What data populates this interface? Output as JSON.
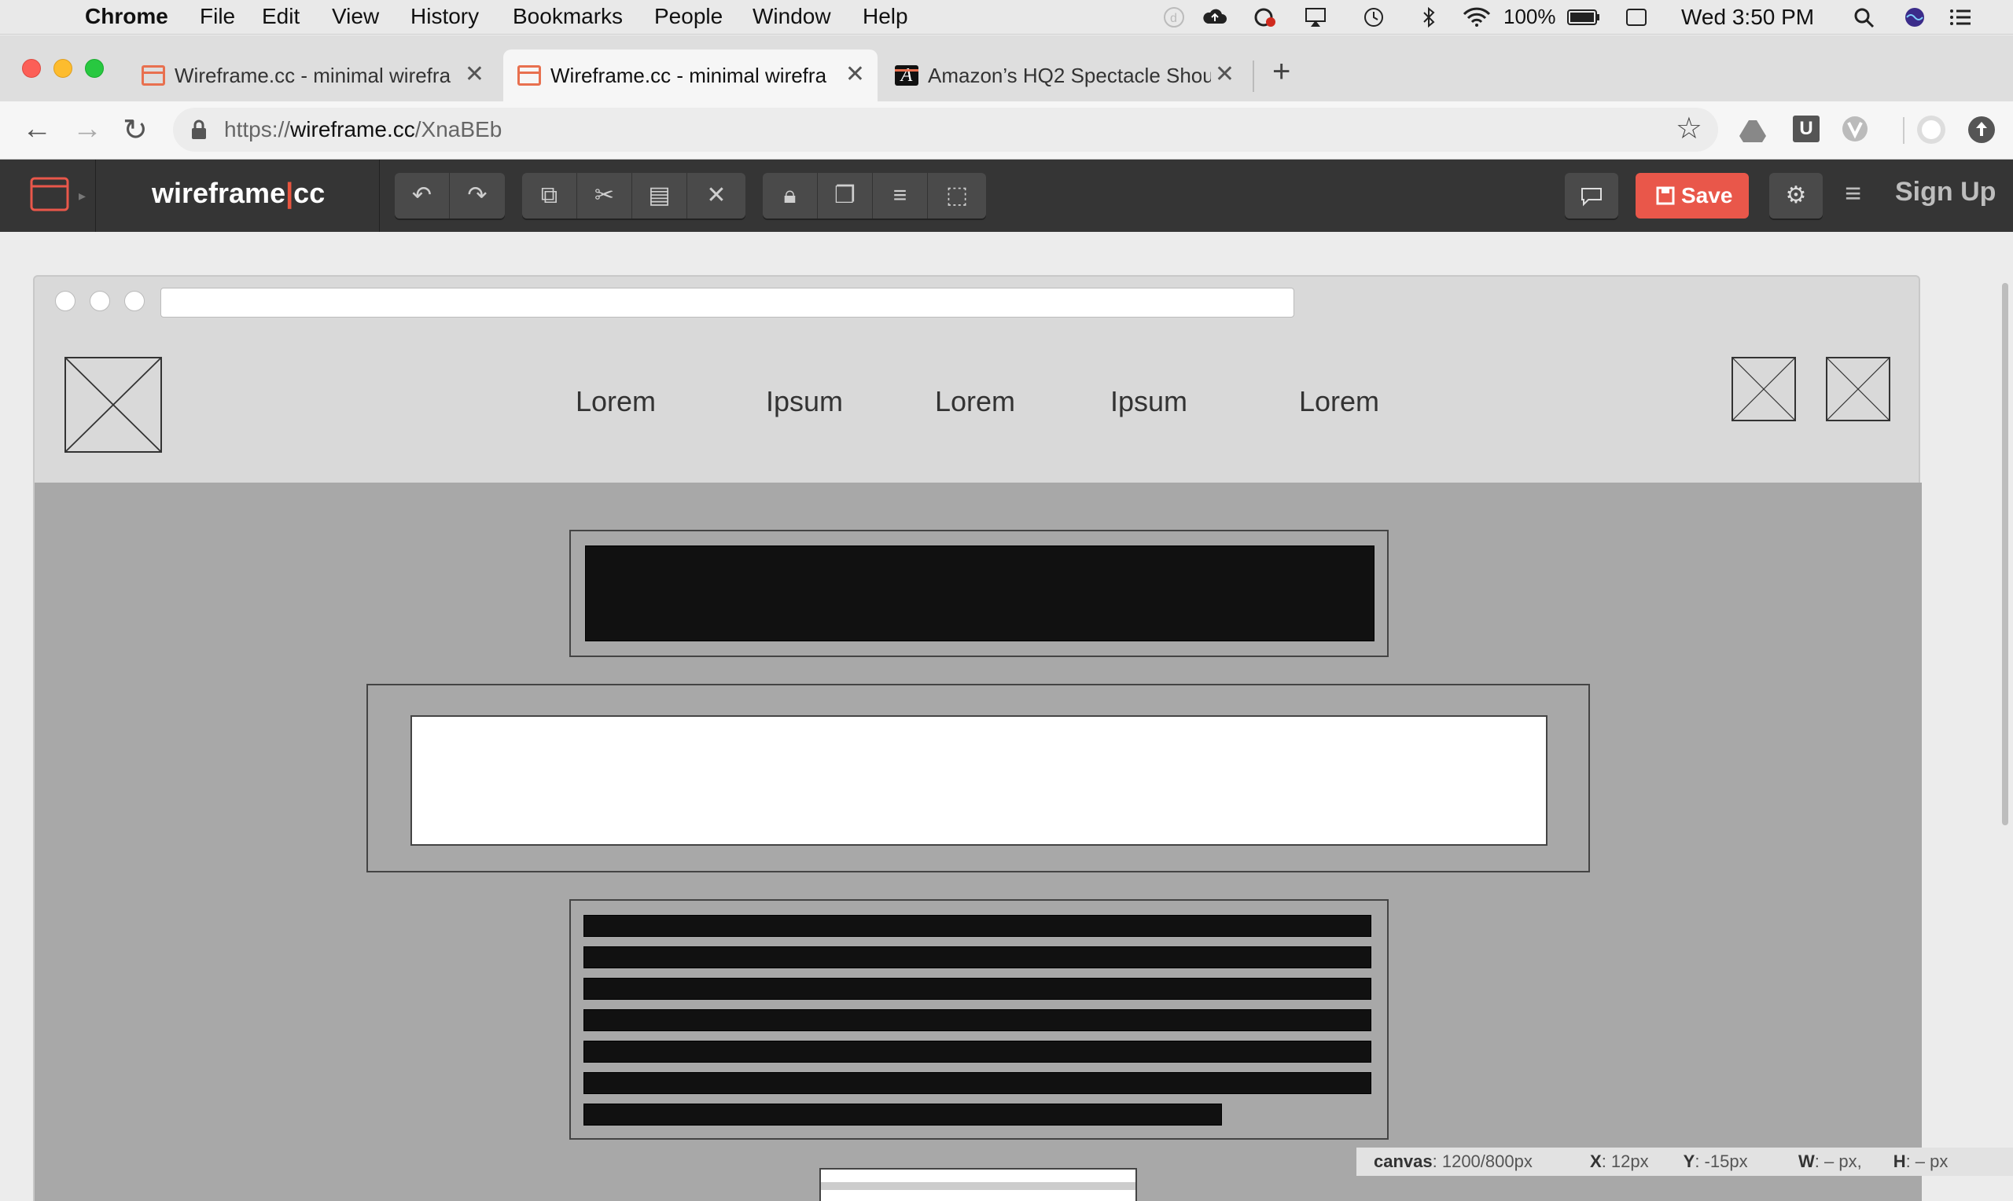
{
  "menubar": {
    "app": "Chrome",
    "items": [
      "File",
      "Edit",
      "View",
      "History",
      "Bookmarks",
      "People",
      "Window",
      "Help"
    ],
    "battery": "100%",
    "clock": "Wed 3:50 PM"
  },
  "tabs": [
    {
      "title": "Wireframe.cc - minimal wirefra",
      "active": false
    },
    {
      "title": "Wireframe.cc - minimal wirefra",
      "active": true
    },
    {
      "title": "Amazon’s HQ2 Spectacle Shou",
      "active": false
    }
  ],
  "address": {
    "scheme": "https://",
    "host": "wireframe.cc",
    "path": "/XnaBEb"
  },
  "app": {
    "logo_left": "wireframe",
    "logo_sep": "|",
    "logo_right": "cc",
    "save_label": "Save",
    "signup_label": "Sign Up",
    "accent": "#e9574a"
  },
  "wireframe": {
    "nav_links": [
      "Lorem",
      "Ipsum",
      "Lorem",
      "Ipsum",
      "Lorem"
    ]
  },
  "status": {
    "canvas_label": "canvas",
    "canvas_value": ": 1200/800px",
    "x_label": "X",
    "x_value": ": 12px",
    "y_label": "Y",
    "y_value": ": -15px",
    "w_label": "W",
    "w_value": ": – px,",
    "h_label": "H",
    "h_value": ": – px"
  }
}
